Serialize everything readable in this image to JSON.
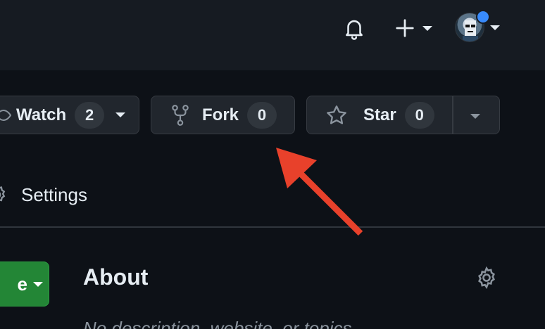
{
  "header": {
    "icons": [
      "bell-icon",
      "plus-icon",
      "chevron-down-icon",
      "avatar",
      "notification-dot"
    ]
  },
  "repo_actions": {
    "watch": {
      "label": "Watch",
      "count": "2"
    },
    "fork": {
      "label": "Fork",
      "count": "0"
    },
    "star": {
      "label": "Star",
      "count": "0"
    }
  },
  "nav": {
    "settings_label": "Settings"
  },
  "main": {
    "code_button_label_fragment": "e",
    "about_title": "About",
    "description_fragment": "No description, website, or topics"
  },
  "annotation": {
    "arrow_color": "#e8412b"
  },
  "colors": {
    "background": "#0d1117",
    "header_bg": "#161b22",
    "button_bg": "#21262d",
    "green": "#238636"
  }
}
